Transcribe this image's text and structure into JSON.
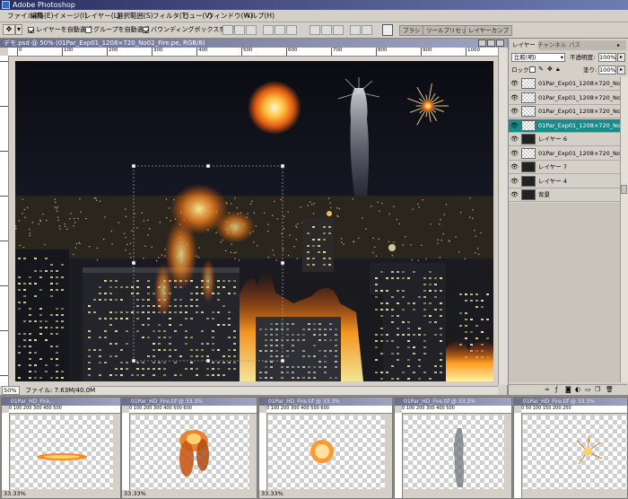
{
  "app": {
    "title": "Adobe Photoshop"
  },
  "menu": [
    "ファイル(F)",
    "編集(E)",
    "イメージ(I)",
    "レイヤー(L)",
    "選択範囲(S)",
    "フィルタ(T)",
    "ビュー(V)",
    "ウィンドウ(W)",
    "ヘルプ(H)"
  ],
  "options": {
    "auto_select_layer": "レイヤーを自動選択",
    "auto_select_group": "グループを自動選択",
    "show_bounding_box": "バウンディングボックスを表示"
  },
  "palette_dock_tabs": [
    "ブラシ",
    "ツールプリセット",
    "レイヤーカンプ"
  ],
  "document": {
    "title": "デモ.psd @ 50% (01Par_Exp01_1208×720_No02_Fire.pe, RGB/8)",
    "zoom": "50%",
    "file_info": "ファイル: 7.63M/40.0M",
    "ruler_labels": [
      "0",
      "100",
      "200",
      "300",
      "400",
      "500",
      "600",
      "700",
      "800",
      "900",
      "1000"
    ]
  },
  "layers_panel": {
    "tabs": [
      "レイヤー",
      "チャンネル",
      "パス"
    ],
    "blend_mode": "比較(明)",
    "opacity_label": "不透明度:",
    "opacity_value": "100%",
    "lock_label": "ロック:",
    "fill_label": "塗り:",
    "fill_value": "100%",
    "layers": [
      {
        "name": "01Par_Exp01_1208×720_No05",
        "selected": false,
        "dark": false
      },
      {
        "name": "01Par_Exp01_1208×720_No04",
        "selected": false,
        "dark": false
      },
      {
        "name": "01Par_Exp01_1208×720_No03",
        "selected": false,
        "dark": false
      },
      {
        "name": "01Par_Exp01_1208×720_No02",
        "selected": true,
        "dark": false
      },
      {
        "name": "レイヤー 6",
        "selected": false,
        "dark": true
      },
      {
        "name": "01Par_Exp01_1208×720_No05",
        "selected": false,
        "dark": false
      },
      {
        "name": "レイヤー 7",
        "selected": false,
        "dark": true
      },
      {
        "name": "レイヤー 4",
        "selected": false,
        "dark": true
      },
      {
        "name": "背景",
        "selected": false,
        "dark": true
      }
    ]
  },
  "small_windows": [
    {
      "title": "01Par_HD_Fire...",
      "zoom": "33.33%",
      "ruler": "0   100   200   300   400   500"
    },
    {
      "title": "01Par_HD_Fire.tif @ 33.3%",
      "zoom": "33.33%",
      "ruler": "0   100   200   300   400   500   600"
    },
    {
      "title": "01Par_HD_Fire.tif @ 33.3%",
      "zoom": "33.33%",
      "ruler": "0   100   200   300   400   500   600"
    },
    {
      "title": "01Par_HD_Fire.tif @ 33.3%",
      "zoom": "33.33%",
      "ruler": "0   100   200   300   400   500"
    },
    {
      "title": "01Par_HD_Fire.tif @ 33.3%",
      "zoom": "33.33%",
      "ruler": "0   50   100   150   200   250"
    }
  ]
}
